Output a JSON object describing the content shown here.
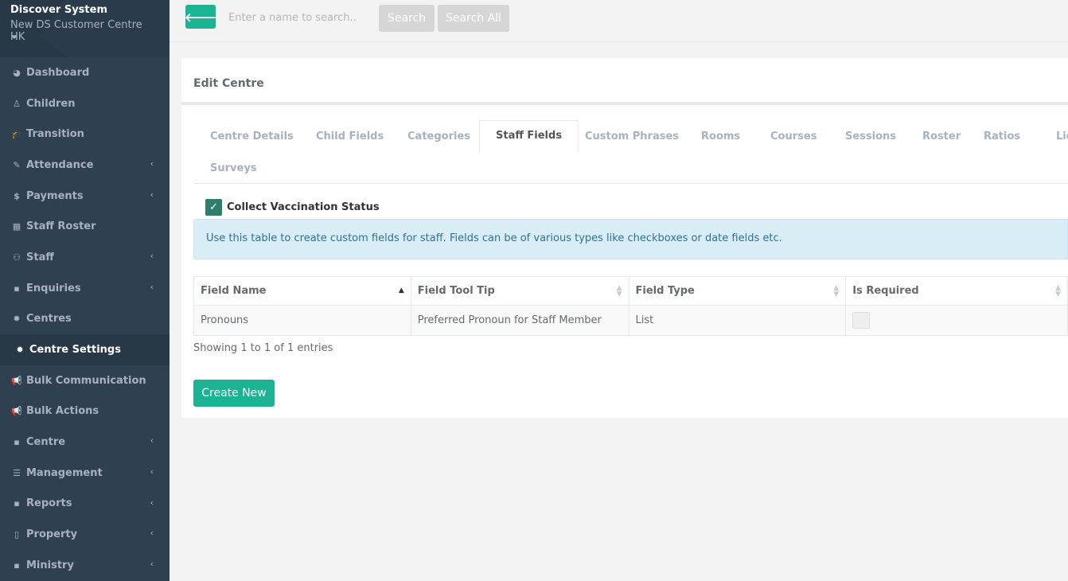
{
  "sidebar": {
    "title": "Discover System",
    "subtitle": "New DS Customer Centre HK",
    "items": [
      {
        "label": "Dashboard",
        "icon": "◕",
        "has_sub": false
      },
      {
        "label": "Children",
        "icon": "♙",
        "has_sub": false
      },
      {
        "label": "Transition",
        "icon": "🎓",
        "has_sub": false
      },
      {
        "label": "Attendance",
        "icon": "✎",
        "has_sub": true
      },
      {
        "label": "Payments",
        "icon": "$",
        "has_sub": true
      },
      {
        "label": "Staff Roster",
        "icon": "▦",
        "has_sub": false
      },
      {
        "label": "Staff",
        "icon": "⚇",
        "has_sub": true
      },
      {
        "label": "Enquiries",
        "icon": "▪",
        "has_sub": true
      },
      {
        "label": "Centres",
        "icon": "✹",
        "has_sub": false
      },
      {
        "label": "Centre Settings",
        "icon": "✹",
        "has_sub": false,
        "active": true
      },
      {
        "label": "Bulk Communication",
        "icon": "📢",
        "has_sub": false
      },
      {
        "label": "Bulk Actions",
        "icon": "📢",
        "has_sub": false
      },
      {
        "label": "Centre",
        "icon": "▪",
        "has_sub": true
      },
      {
        "label": "Management",
        "icon": "☰",
        "has_sub": true
      },
      {
        "label": "Reports",
        "icon": "▪",
        "has_sub": true
      },
      {
        "label": "Property",
        "icon": "▯",
        "has_sub": true
      },
      {
        "label": "Ministry",
        "icon": "▪",
        "has_sub": true
      }
    ]
  },
  "topbar": {
    "search_placeholder": "Enter a name to search..",
    "search_label": "Search",
    "search_all_label": "Search All"
  },
  "panel": {
    "title": "Edit Centre",
    "tabs": [
      {
        "label": "Centre Details"
      },
      {
        "label": "Child Fields"
      },
      {
        "label": "Categories"
      },
      {
        "label": "Staff Fields",
        "active": true
      },
      {
        "label": "Custom Phrases"
      },
      {
        "label": "Rooms"
      },
      {
        "label": "Courses"
      },
      {
        "label": "Sessions"
      },
      {
        "label": "Roster"
      },
      {
        "label": "Ratios"
      },
      {
        "label": "Lic"
      },
      {
        "label": "Surveys"
      }
    ],
    "checkbox_label": "Collect Vaccination Status",
    "checkbox_checked": true,
    "info_text": "Use this table to create custom fields for staff. Fields can be of various types like checkboxes or date fields etc.",
    "table": {
      "columns": [
        "Field Name",
        "Field Tool Tip",
        "Field Type",
        "Is Required"
      ],
      "rows": [
        [
          "Pronouns",
          "Preferred Pronoun for Staff Member",
          "List",
          ""
        ]
      ]
    },
    "entries_text": "Showing 1 to 1 of 1 entries",
    "create_label": "Create New"
  },
  "colors": {
    "sidebar_bg": "#2f4050",
    "accent": "#1ab394",
    "info_bg": "#d9edf7"
  }
}
